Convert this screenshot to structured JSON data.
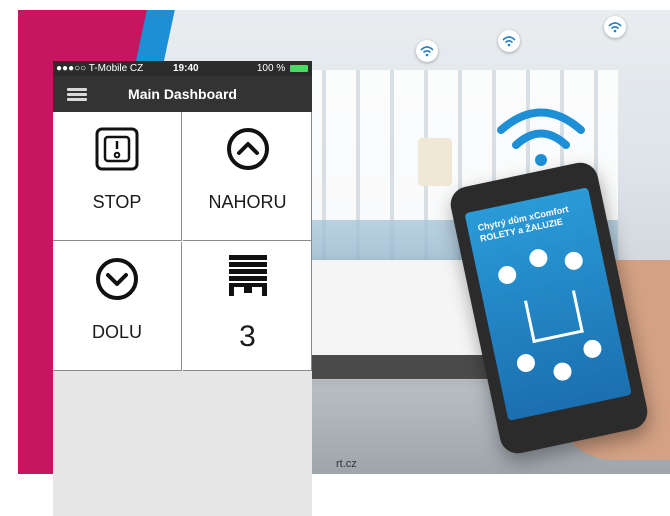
{
  "status_bar": {
    "carrier": "●●●○○ T-Mobile CZ",
    "time": "19:40",
    "battery_percent": "100 %"
  },
  "header": {
    "title": "Main Dashboard",
    "menu_icon": "hamburger-icon"
  },
  "tiles": [
    {
      "label": "STOP",
      "icon": "switch-icon"
    },
    {
      "label": "NAHORU",
      "icon": "chevron-up-circle-icon"
    },
    {
      "label": "DOLU",
      "icon": "chevron-down-circle-icon"
    },
    {
      "label": "3",
      "icon": "blinds-icon"
    }
  ],
  "promo": {
    "phone_title_line1": "Chytrý dům xComfort",
    "phone_title_line2": "ROLETY a ŽALUZIE",
    "url_fragment": "rt.cz"
  },
  "colors": {
    "promo_magenta": "#c8155f",
    "nav_bar": "#333333",
    "status_bar": "#2c2c2c",
    "battery": "#4cd964"
  }
}
